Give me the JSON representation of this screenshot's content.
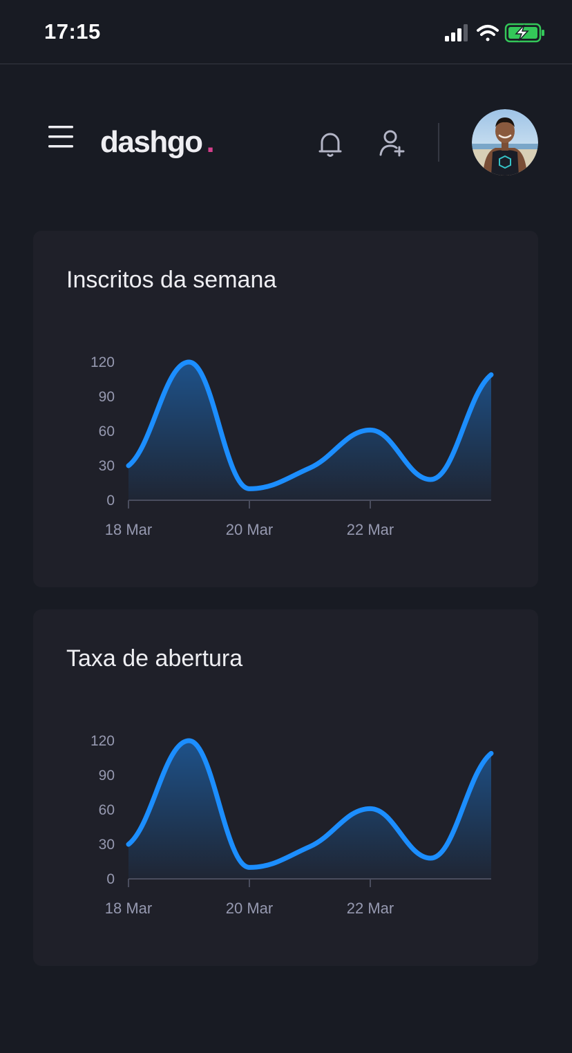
{
  "status_bar": {
    "time": "17:15",
    "icons": [
      "signal-icon",
      "wifi-icon",
      "battery-charging-icon"
    ],
    "battery_color": "#34c759"
  },
  "header": {
    "logo_text": "dashgo",
    "logo_dot": ".",
    "accent_color": "#d53f8c",
    "icons": [
      "menu-icon",
      "bell-icon",
      "user-add-icon"
    ],
    "avatar": "avatar"
  },
  "cards": [
    {
      "title": "Inscritos da semana"
    },
    {
      "title": "Taxa de abertura"
    }
  ],
  "chart_data": [
    {
      "type": "area",
      "title": "Inscritos da semana",
      "x": [
        "18 Mar",
        "19 Mar",
        "20 Mar",
        "21 Mar",
        "22 Mar",
        "23 Mar",
        "24 Mar"
      ],
      "xtick_labels": [
        "18 Mar",
        "20 Mar",
        "22 Mar"
      ],
      "y": [
        30,
        120,
        10,
        28,
        61,
        18,
        109
      ],
      "yticks": [
        0,
        30,
        60,
        90,
        120
      ],
      "ylim": [
        0,
        120
      ],
      "grid": false,
      "line_color": "#1c8eff"
    },
    {
      "type": "area",
      "title": "Taxa de abertura",
      "x": [
        "18 Mar",
        "19 Mar",
        "20 Mar",
        "21 Mar",
        "22 Mar",
        "23 Mar",
        "24 Mar"
      ],
      "xtick_labels": [
        "18 Mar",
        "20 Mar",
        "22 Mar"
      ],
      "y": [
        30,
        120,
        10,
        28,
        61,
        18,
        109
      ],
      "yticks": [
        0,
        30,
        60,
        90,
        120
      ],
      "ylim": [
        0,
        120
      ],
      "grid": false,
      "line_color": "#1c8eff"
    }
  ]
}
